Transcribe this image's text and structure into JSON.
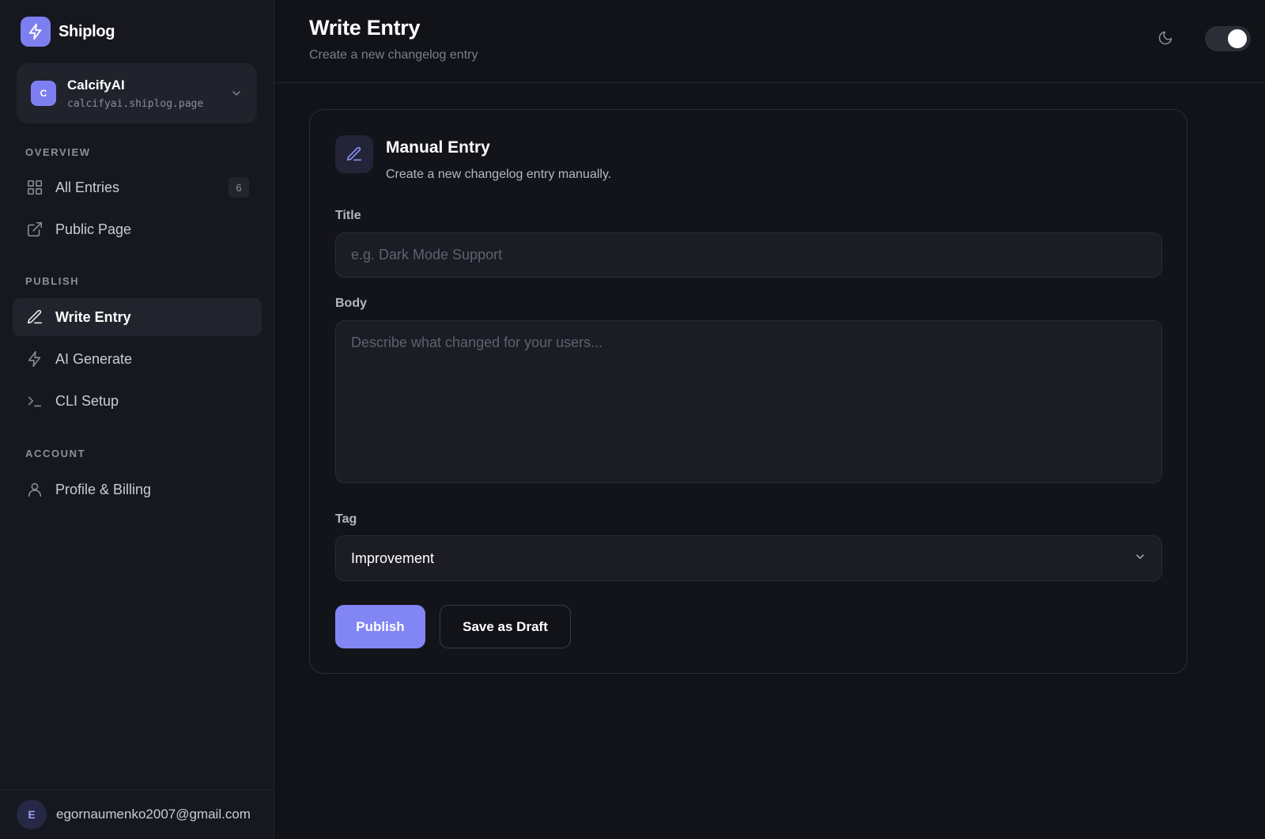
{
  "brand": {
    "name": "Shiplog"
  },
  "workspace": {
    "avatar": "C",
    "name": "CalcifyAI",
    "domain": "calcifyai.shiplog.page"
  },
  "sidebar": {
    "sections": {
      "overview": "OVERVIEW",
      "publish": "PUBLISH",
      "account": "ACCOUNT"
    },
    "items": {
      "all_entries": {
        "label": "All Entries",
        "badge": "6",
        "icon": "grid-icon"
      },
      "public_page": {
        "label": "Public Page",
        "icon": "external-link-icon"
      },
      "write_entry": {
        "label": "Write Entry",
        "icon": "pen-icon",
        "active": true
      },
      "ai_generate": {
        "label": "AI Generate",
        "icon": "lightning-icon"
      },
      "cli_setup": {
        "label": "CLI Setup",
        "icon": "terminal-icon"
      },
      "profile_billing": {
        "label": "Profile & Billing",
        "icon": "user-icon"
      }
    }
  },
  "user": {
    "avatar": "E",
    "email": "egornaumenko2007@gmail.com"
  },
  "header": {
    "title": "Write Entry",
    "subtitle": "Create a new changelog entry",
    "theme_toggle": "on"
  },
  "card": {
    "title": "Manual Entry",
    "description": "Create a new changelog entry manually.",
    "fields": {
      "title": {
        "label": "Title",
        "placeholder": "e.g. Dark Mode Support",
        "value": ""
      },
      "body": {
        "label": "Body",
        "placeholder": "Describe what changed for your users...",
        "value": ""
      },
      "tag": {
        "label": "Tag",
        "value": "Improvement"
      }
    },
    "actions": {
      "publish": "Publish",
      "save_draft": "Save as Draft"
    }
  },
  "colors": {
    "accent": "#7d7ff0",
    "background": "#121318",
    "sidebar": "#17181f"
  }
}
